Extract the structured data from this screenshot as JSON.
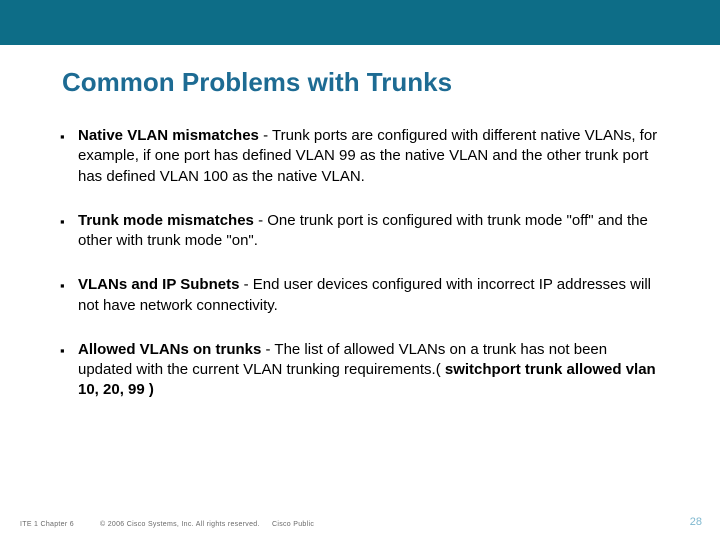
{
  "header": {
    "title": "Common Problems with Trunks"
  },
  "bullets": [
    {
      "bold": "Native VLAN mismatches",
      "rest": " - Trunk ports are configured with different native VLANs, for example, if one port has defined VLAN 99 as the native VLAN and the other trunk port has defined VLAN 100 as the native VLAN."
    },
    {
      "bold": "Trunk mode mismatches",
      "rest": " - One trunk port is configured with trunk mode \"off\" and the other with trunk mode \"on\"."
    },
    {
      "bold": "VLANs and IP Subnets",
      "rest": " - End user devices configured with incorrect IP addresses will not have network connectivity."
    },
    {
      "bold": "Allowed VLANs on trunks",
      "rest": " - The list of allowed VLANs on a trunk has not been updated with the current VLAN trunking requirements.( ",
      "tail_bold": "switchport trunk allowed vlan 10, 20, 99 )"
    }
  ],
  "footer": {
    "left": "ITE 1 Chapter 6",
    "center": "© 2006 Cisco Systems, Inc. All rights reserved.",
    "public": "Cisco Public",
    "page": "28"
  }
}
